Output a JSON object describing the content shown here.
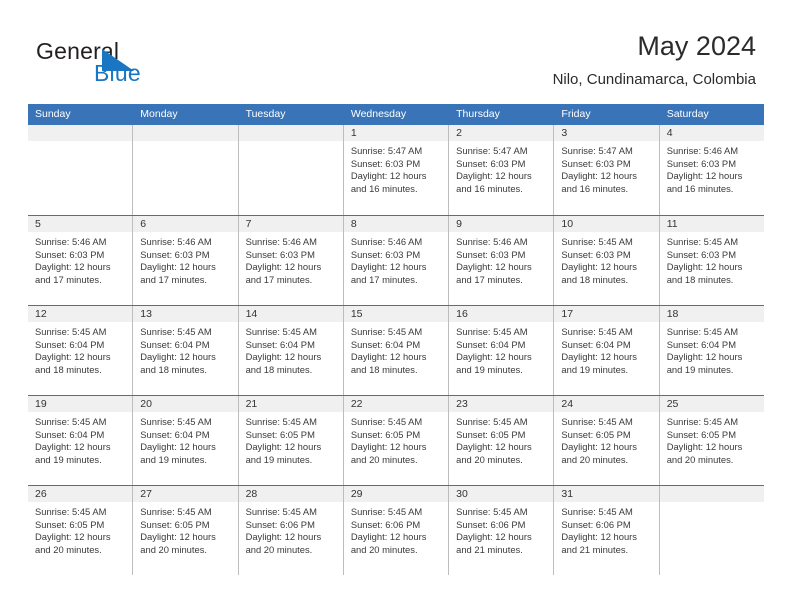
{
  "brand": {
    "word_one": "General",
    "word_two": "Blue",
    "flag_icon": "blue-triangle-flag-icon",
    "accent_color": "#1a76c2"
  },
  "header": {
    "title": "May 2024",
    "location": "Nilo, Cundinamarca, Colombia"
  },
  "colors": {
    "header_blue": "#3a74b8",
    "daynum_band": "#f0f0f0",
    "cell_border": "#bdbdbd"
  },
  "weekdays": [
    "Sunday",
    "Monday",
    "Tuesday",
    "Wednesday",
    "Thursday",
    "Friday",
    "Saturday"
  ],
  "weeks": [
    [
      {
        "date": "",
        "empty": true
      },
      {
        "date": "",
        "empty": true
      },
      {
        "date": "",
        "empty": true
      },
      {
        "date": "1",
        "sunrise": "Sunrise: 5:47 AM",
        "sunset": "Sunset: 6:03 PM",
        "daylight_1": "Daylight: 12 hours",
        "daylight_2": "and 16 minutes."
      },
      {
        "date": "2",
        "sunrise": "Sunrise: 5:47 AM",
        "sunset": "Sunset: 6:03 PM",
        "daylight_1": "Daylight: 12 hours",
        "daylight_2": "and 16 minutes."
      },
      {
        "date": "3",
        "sunrise": "Sunrise: 5:47 AM",
        "sunset": "Sunset: 6:03 PM",
        "daylight_1": "Daylight: 12 hours",
        "daylight_2": "and 16 minutes."
      },
      {
        "date": "4",
        "sunrise": "Sunrise: 5:46 AM",
        "sunset": "Sunset: 6:03 PM",
        "daylight_1": "Daylight: 12 hours",
        "daylight_2": "and 16 minutes."
      }
    ],
    [
      {
        "date": "5",
        "sunrise": "Sunrise: 5:46 AM",
        "sunset": "Sunset: 6:03 PM",
        "daylight_1": "Daylight: 12 hours",
        "daylight_2": "and 17 minutes."
      },
      {
        "date": "6",
        "sunrise": "Sunrise: 5:46 AM",
        "sunset": "Sunset: 6:03 PM",
        "daylight_1": "Daylight: 12 hours",
        "daylight_2": "and 17 minutes."
      },
      {
        "date": "7",
        "sunrise": "Sunrise: 5:46 AM",
        "sunset": "Sunset: 6:03 PM",
        "daylight_1": "Daylight: 12 hours",
        "daylight_2": "and 17 minutes."
      },
      {
        "date": "8",
        "sunrise": "Sunrise: 5:46 AM",
        "sunset": "Sunset: 6:03 PM",
        "daylight_1": "Daylight: 12 hours",
        "daylight_2": "and 17 minutes."
      },
      {
        "date": "9",
        "sunrise": "Sunrise: 5:46 AM",
        "sunset": "Sunset: 6:03 PM",
        "daylight_1": "Daylight: 12 hours",
        "daylight_2": "and 17 minutes."
      },
      {
        "date": "10",
        "sunrise": "Sunrise: 5:45 AM",
        "sunset": "Sunset: 6:03 PM",
        "daylight_1": "Daylight: 12 hours",
        "daylight_2": "and 18 minutes."
      },
      {
        "date": "11",
        "sunrise": "Sunrise: 5:45 AM",
        "sunset": "Sunset: 6:03 PM",
        "daylight_1": "Daylight: 12 hours",
        "daylight_2": "and 18 minutes."
      }
    ],
    [
      {
        "date": "12",
        "sunrise": "Sunrise: 5:45 AM",
        "sunset": "Sunset: 6:04 PM",
        "daylight_1": "Daylight: 12 hours",
        "daylight_2": "and 18 minutes."
      },
      {
        "date": "13",
        "sunrise": "Sunrise: 5:45 AM",
        "sunset": "Sunset: 6:04 PM",
        "daylight_1": "Daylight: 12 hours",
        "daylight_2": "and 18 minutes."
      },
      {
        "date": "14",
        "sunrise": "Sunrise: 5:45 AM",
        "sunset": "Sunset: 6:04 PM",
        "daylight_1": "Daylight: 12 hours",
        "daylight_2": "and 18 minutes."
      },
      {
        "date": "15",
        "sunrise": "Sunrise: 5:45 AM",
        "sunset": "Sunset: 6:04 PM",
        "daylight_1": "Daylight: 12 hours",
        "daylight_2": "and 18 minutes."
      },
      {
        "date": "16",
        "sunrise": "Sunrise: 5:45 AM",
        "sunset": "Sunset: 6:04 PM",
        "daylight_1": "Daylight: 12 hours",
        "daylight_2": "and 19 minutes."
      },
      {
        "date": "17",
        "sunrise": "Sunrise: 5:45 AM",
        "sunset": "Sunset: 6:04 PM",
        "daylight_1": "Daylight: 12 hours",
        "daylight_2": "and 19 minutes."
      },
      {
        "date": "18",
        "sunrise": "Sunrise: 5:45 AM",
        "sunset": "Sunset: 6:04 PM",
        "daylight_1": "Daylight: 12 hours",
        "daylight_2": "and 19 minutes."
      }
    ],
    [
      {
        "date": "19",
        "sunrise": "Sunrise: 5:45 AM",
        "sunset": "Sunset: 6:04 PM",
        "daylight_1": "Daylight: 12 hours",
        "daylight_2": "and 19 minutes."
      },
      {
        "date": "20",
        "sunrise": "Sunrise: 5:45 AM",
        "sunset": "Sunset: 6:04 PM",
        "daylight_1": "Daylight: 12 hours",
        "daylight_2": "and 19 minutes."
      },
      {
        "date": "21",
        "sunrise": "Sunrise: 5:45 AM",
        "sunset": "Sunset: 6:05 PM",
        "daylight_1": "Daylight: 12 hours",
        "daylight_2": "and 19 minutes."
      },
      {
        "date": "22",
        "sunrise": "Sunrise: 5:45 AM",
        "sunset": "Sunset: 6:05 PM",
        "daylight_1": "Daylight: 12 hours",
        "daylight_2": "and 20 minutes."
      },
      {
        "date": "23",
        "sunrise": "Sunrise: 5:45 AM",
        "sunset": "Sunset: 6:05 PM",
        "daylight_1": "Daylight: 12 hours",
        "daylight_2": "and 20 minutes."
      },
      {
        "date": "24",
        "sunrise": "Sunrise: 5:45 AM",
        "sunset": "Sunset: 6:05 PM",
        "daylight_1": "Daylight: 12 hours",
        "daylight_2": "and 20 minutes."
      },
      {
        "date": "25",
        "sunrise": "Sunrise: 5:45 AM",
        "sunset": "Sunset: 6:05 PM",
        "daylight_1": "Daylight: 12 hours",
        "daylight_2": "and 20 minutes."
      }
    ],
    [
      {
        "date": "26",
        "sunrise": "Sunrise: 5:45 AM",
        "sunset": "Sunset: 6:05 PM",
        "daylight_1": "Daylight: 12 hours",
        "daylight_2": "and 20 minutes."
      },
      {
        "date": "27",
        "sunrise": "Sunrise: 5:45 AM",
        "sunset": "Sunset: 6:05 PM",
        "daylight_1": "Daylight: 12 hours",
        "daylight_2": "and 20 minutes."
      },
      {
        "date": "28",
        "sunrise": "Sunrise: 5:45 AM",
        "sunset": "Sunset: 6:06 PM",
        "daylight_1": "Daylight: 12 hours",
        "daylight_2": "and 20 minutes."
      },
      {
        "date": "29",
        "sunrise": "Sunrise: 5:45 AM",
        "sunset": "Sunset: 6:06 PM",
        "daylight_1": "Daylight: 12 hours",
        "daylight_2": "and 20 minutes."
      },
      {
        "date": "30",
        "sunrise": "Sunrise: 5:45 AM",
        "sunset": "Sunset: 6:06 PM",
        "daylight_1": "Daylight: 12 hours",
        "daylight_2": "and 21 minutes."
      },
      {
        "date": "31",
        "sunrise": "Sunrise: 5:45 AM",
        "sunset": "Sunset: 6:06 PM",
        "daylight_1": "Daylight: 12 hours",
        "daylight_2": "and 21 minutes."
      },
      {
        "date": "",
        "empty": true
      }
    ]
  ]
}
